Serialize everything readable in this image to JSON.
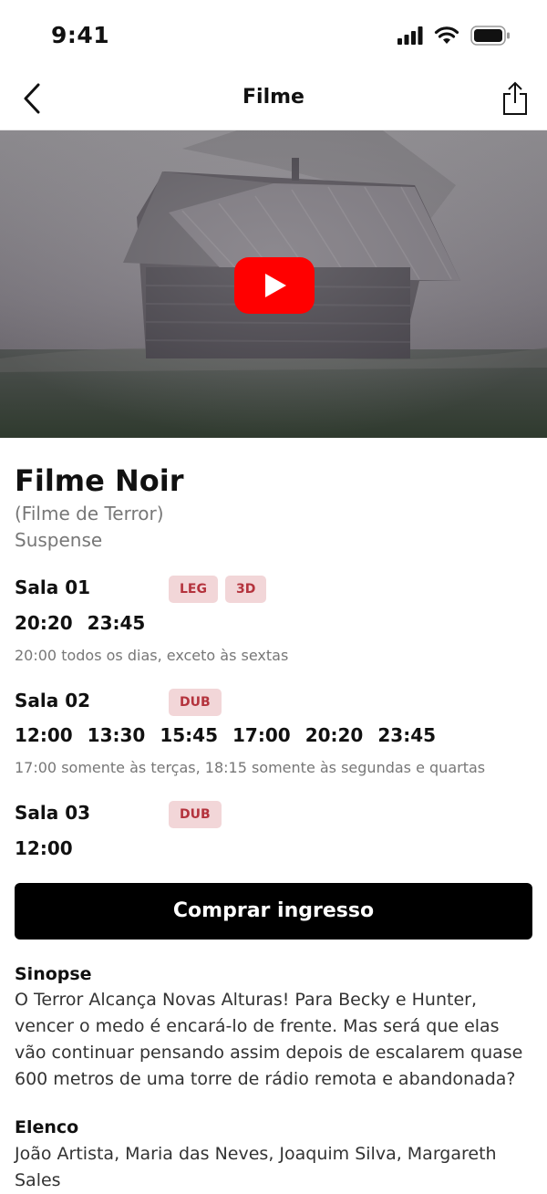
{
  "status": {
    "time": "9:41"
  },
  "nav": {
    "title": "Filme",
    "back_icon": "chevron-left-icon",
    "share_icon": "share-icon"
  },
  "video": {
    "play_icon": "youtube-play-icon",
    "play_color": "#ff0000"
  },
  "movie": {
    "title": "Filme Noir",
    "original_title": "(Filme de Terror)",
    "genre": "Suspense"
  },
  "rooms": [
    {
      "name": "Sala 01",
      "badges": [
        "LEG",
        "3D"
      ],
      "times": [
        "20:20",
        "23:45"
      ],
      "note": "20:00 todos os dias, exceto às sextas"
    },
    {
      "name": "Sala 02",
      "badges": [
        "DUB"
      ],
      "times": [
        "12:00",
        "13:30",
        "15:45",
        "17:00",
        "20:20",
        "23:45"
      ],
      "note": "17:00 somente às terças, 18:15 somente às segundas e quartas"
    },
    {
      "name": "Sala 03",
      "badges": [
        "DUB"
      ],
      "times": [
        "12:00"
      ],
      "note": ""
    }
  ],
  "buy_button": {
    "label": "Comprar ingresso"
  },
  "synopsis": {
    "title": "Sinopse",
    "text": "O Terror Alcança Novas Alturas! Para Becky e Hunter, vencer o medo é encará-lo de frente. Mas será que elas vão continuar pensando assim depois de escalarem quase 600 metros de uma torre de rádio remota e abandonada?"
  },
  "cast": {
    "title": "Elenco",
    "text": "João Artista, Maria das Neves, Joaquim Silva, Margareth Sales"
  },
  "colors": {
    "badge_bg": "#f2d6d8",
    "badge_text": "#b4333d",
    "button_bg": "#000000"
  }
}
